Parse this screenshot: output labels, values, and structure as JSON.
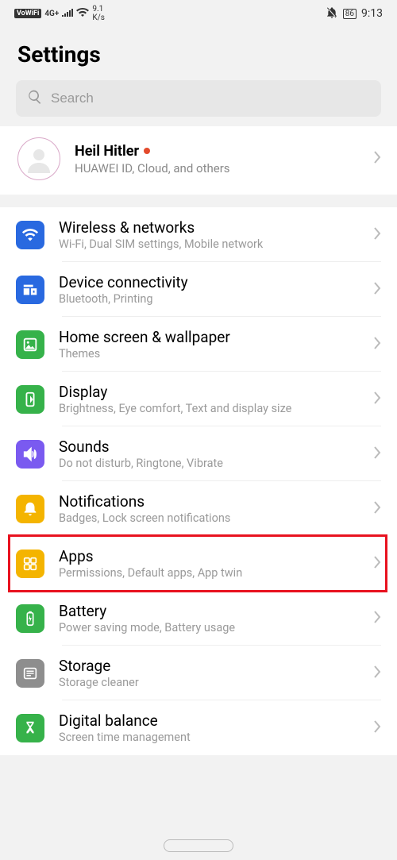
{
  "status": {
    "vowifi": "VoWiFi",
    "net": "4G+",
    "speed_top": "9.1",
    "speed_bot": "K/s",
    "battery": "86",
    "time": "9:13"
  },
  "title": "Settings",
  "search": {
    "placeholder": "Search"
  },
  "account": {
    "name": "Heil Hitler",
    "sub": "HUAWEI ID, Cloud, and others"
  },
  "items": [
    {
      "title": "Wireless & networks",
      "sub": "Wi-Fi, Dual SIM settings, Mobile network"
    },
    {
      "title": "Device connectivity",
      "sub": "Bluetooth, Printing"
    },
    {
      "title": "Home screen & wallpaper",
      "sub": "Themes"
    },
    {
      "title": "Display",
      "sub": "Brightness, Eye comfort, Text and display size"
    },
    {
      "title": "Sounds",
      "sub": "Do not disturb, Ringtone, Vibrate"
    },
    {
      "title": "Notifications",
      "sub": "Badges, Lock screen notifications"
    },
    {
      "title": "Apps",
      "sub": "Permissions, Default apps, App twin"
    },
    {
      "title": "Battery",
      "sub": "Power saving mode, Battery usage"
    },
    {
      "title": "Storage",
      "sub": "Storage cleaner"
    },
    {
      "title": "Digital balance",
      "sub": "Screen time management"
    }
  ]
}
